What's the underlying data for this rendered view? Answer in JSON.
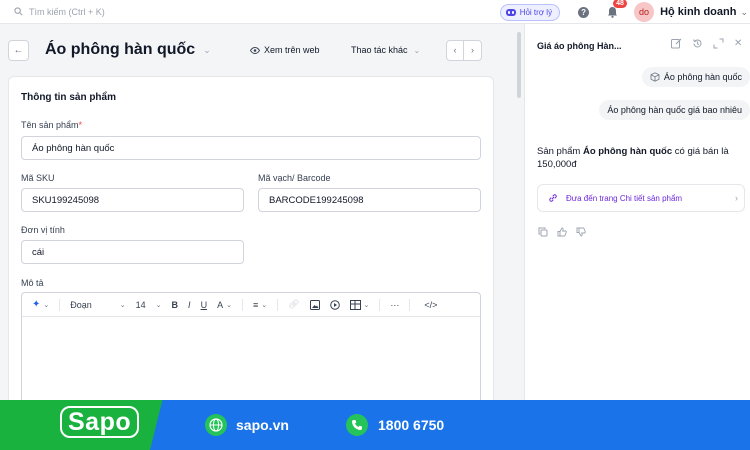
{
  "topbar": {
    "search_placeholder": "Tìm kiếm (Ctrl + K)",
    "assistant_label": "Hỏi trợ lý",
    "notification_count": "48",
    "avatar_initials": "do",
    "business_name": "Hộ kinh doanh"
  },
  "header": {
    "title": "Áo phông hàn quốc",
    "view_web": "Xem trên web",
    "more_actions": "Thao tác khác"
  },
  "product_info": {
    "section_title": "Thông tin sản phẩm",
    "name_label": "Tên sản phẩm",
    "name_required": "*",
    "name_value": "Áo phông hàn quốc",
    "sku_label": "Mã SKU",
    "sku_value": "SKU199245098",
    "barcode_label": "Mã vạch/ Barcode",
    "barcode_value": "BARCODE199245098",
    "unit_label": "Đơn vị tính",
    "unit_value": "cái",
    "desc_label": "Mô tả",
    "editor": {
      "paragraph": "Đoạn",
      "font_size": "14",
      "bold": "B",
      "italic": "I",
      "underline": "U",
      "font_color": "A",
      "more": "···",
      "code": "</>"
    }
  },
  "assistant": {
    "title": "Giá áo phông Hàn...",
    "context_chip": "Áo phông hàn quốc",
    "user_question": "Áo phông hàn quốc giá bao nhiêu",
    "answer_prefix": "Sản phẩm ",
    "answer_product": "Áo phông hàn quốc",
    "answer_suffix": " có giá bán là 150,000đ",
    "link_text": "Đưa đến trang Chi tiết sản phẩm"
  },
  "banner": {
    "brand": "Sapo",
    "website": "sapo.vn",
    "phone": "1800 6750"
  },
  "colors": {
    "banner_green": "#1ab23f",
    "banner_blue": "#1a73e8",
    "accent_purple": "#6d28d9",
    "notification_red": "#ef4444"
  }
}
